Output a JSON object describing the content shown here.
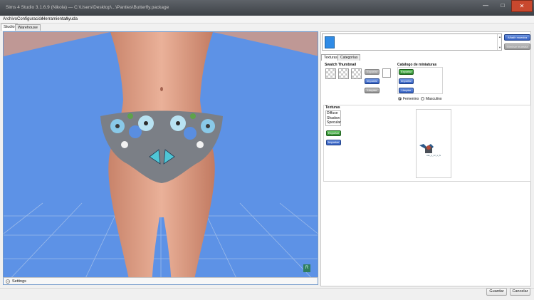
{
  "window": {
    "title": "Sims 4 Studio 3.1.6.9 (Nikola) — C:\\Users\\Desktop\\...\\Panties\\Butterfly.package",
    "min_icon": "minimize-icon",
    "max_icon": "maximize-icon",
    "close_icon": "close-icon"
  },
  "menu": [
    "Archivo",
    "Configuración",
    "Herramientas",
    "Ayuda"
  ],
  "main_tabs": [
    "Studio",
    "Warehouse"
  ],
  "viewport": {
    "settings_label": "Settings",
    "corner_badge": "R",
    "background_color": "#5d92e6"
  },
  "presets": {
    "add_label": "Añadir muestra",
    "remove_label": "Eliminar muestra",
    "swatch_color": "#2f8be6"
  },
  "sub_tabs": [
    "Texturas",
    "Categorías"
  ],
  "swatch_thumbnail": {
    "title": "Swatch Thumbnail",
    "export_label": "Exportar",
    "import_label": "Importar",
    "clean_label": "Limpiar"
  },
  "catalog": {
    "title": "Catálogo de miniaturas",
    "export_label": "Exportar",
    "import_label": "Importar",
    "clean_label": "Limpiar",
    "gender": [
      "Femenino",
      "Masculino"
    ],
    "selected_gender": "Femenino"
  },
  "textures": {
    "title": "Texturas",
    "items": [
      "Diffuse",
      "Shadow",
      "Specular"
    ],
    "export_label": "Exportar",
    "import_label": "Importar",
    "preview_caption": "cas_p_nc_s_fs"
  },
  "footer": {
    "save_label": "Guardar",
    "cancel_label": "Cancelar"
  }
}
